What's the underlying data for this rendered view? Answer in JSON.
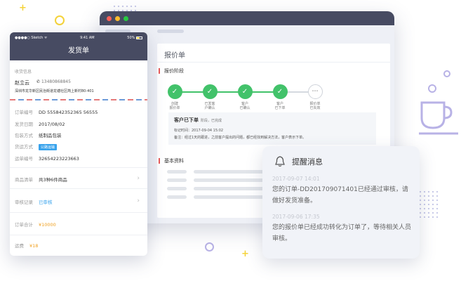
{
  "colors": {
    "accent": "#474b62",
    "success": "#42c26a",
    "danger": "#e85a5a",
    "link": "#39a3ec",
    "price": "#f0a020"
  },
  "desktop": {
    "page_title": "报价单",
    "stage_section": "报价阶段",
    "steps": [
      {
        "label": "创建\n报价单",
        "done": true
      },
      {
        "label": "已发客\n户确认",
        "done": true
      },
      {
        "label": "客户\n已确认",
        "done": true
      },
      {
        "label": "客户\n已下单",
        "done": true
      },
      {
        "label": "报价单\n已失效",
        "done": false
      }
    ],
    "status_title": "客户已下单",
    "status_sub": "阶段，已完成",
    "status_time": "标记时间：2017-09-04 15:02",
    "status_note": "备注：经过1天的跟进，之前客户提出的问题，都已经找到解决方法，客户表示下单。",
    "basic_section": "基本资料"
  },
  "phone": {
    "status_left": "●●●●○ Sketch ᯤ",
    "status_time": "9:41 AM",
    "status_battery": "50%",
    "title": "发货单",
    "recv_section": "收货信息",
    "recv_name": "赵立云",
    "recv_phone": "13480868845",
    "recv_addr": "深圳市龙华新区民治街道龙塘社区简上新村80-401",
    "rows": [
      {
        "label": "订单编号",
        "value": "DD 555842352365 56555"
      },
      {
        "label": "发货日期",
        "value": "2017/08/02"
      },
      {
        "label": "包装方式",
        "value": "纸制品包装"
      },
      {
        "label": "货运方式",
        "value": "公路运输"
      },
      {
        "label": "运单编号",
        "value": "32654223223663"
      }
    ],
    "goods_label": "商品清单",
    "goods_value": "共3种6件商品",
    "audit_label": "审核记录",
    "audit_value": "已审核",
    "total_label": "订单合计",
    "total_value": "¥10000",
    "freight_label": "运费",
    "freight_value": "¥18"
  },
  "notification": {
    "title": "提醒消息",
    "messages": [
      {
        "time": "2017-09-07 14:01",
        "text": "您的订单-DD201709071401已经通过审核，请做好发货准备。"
      },
      {
        "time": "2017-09-06 17:35",
        "text": "您的报价单已经成功转化为订单了，等待相关人员审核。"
      }
    ]
  }
}
